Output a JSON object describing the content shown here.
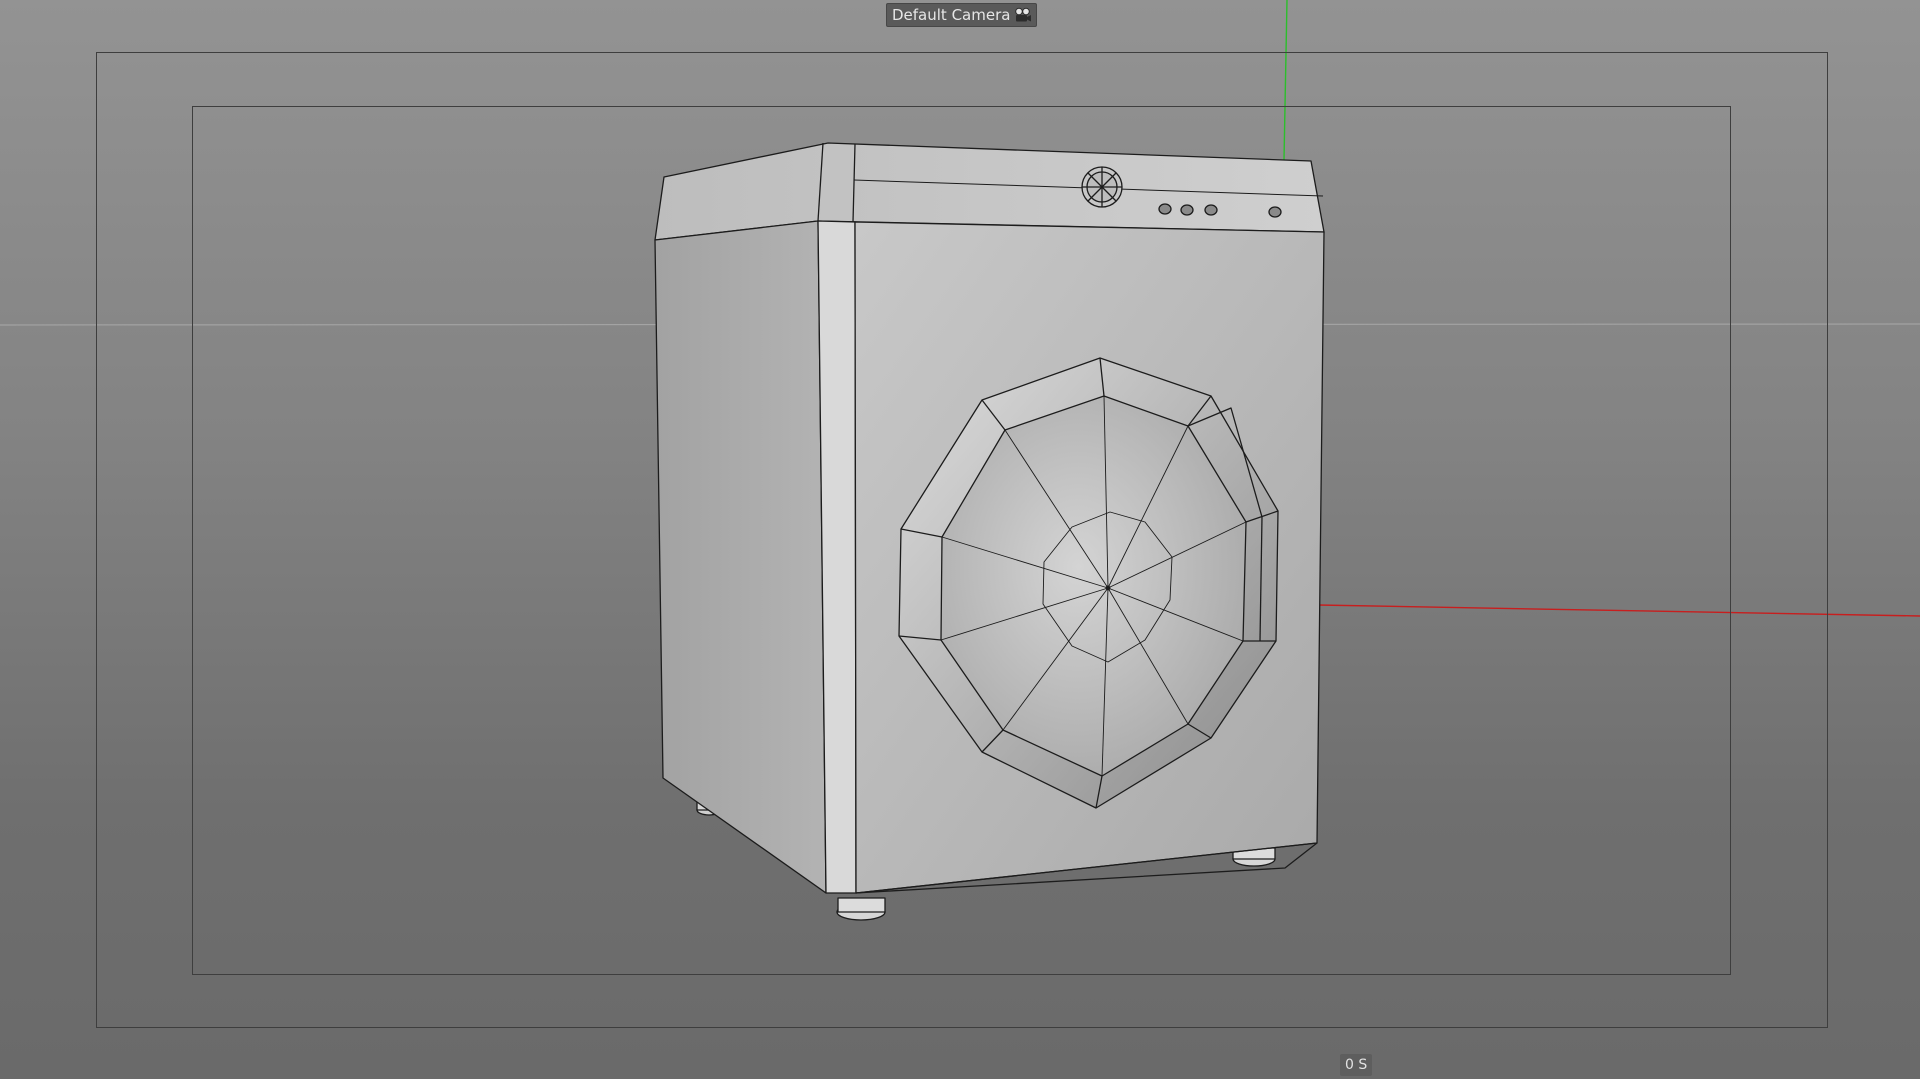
{
  "viewport": {
    "camera_label": "Default Camera",
    "camera_icon": "camera-icon",
    "time_display": "0 S",
    "background_top": "#939393",
    "background_bottom": "#6a6a6a",
    "frame_color": "#3e3e3e",
    "axes": {
      "x_color": "#c81e1e",
      "y_color": "#2bbf2b",
      "horizon_color": "#a8a8a8"
    }
  },
  "model": {
    "object": "washing-machine",
    "display_mode": "gouraud-shading-lines",
    "body_color": "#b9b9b9",
    "wire_color": "#1c1c1c"
  }
}
